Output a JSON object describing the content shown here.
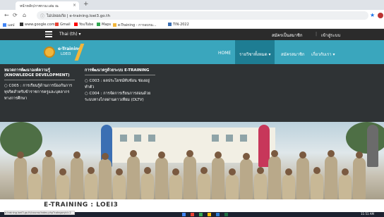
{
  "browser": {
    "tab_title": "หน้าหลัก/ภาพรวม:เล่ม ณ",
    "tab_close": "×",
    "new_tab": "+",
    "url": "ไม่ปลอดภัย | e-training.loei3.go.th",
    "star": "★",
    "bookmarks": [
      "แอป",
      "www.google.com",
      "Gmail",
      "YouTube",
      "Maps",
      "e-Training - การอบรม...",
      "TIN-2022"
    ]
  },
  "site_top": {
    "language": "Thai (th) ▾",
    "signup": "สมัครเป็นสมาชิก",
    "separator": "|",
    "login": "เข้าสู่ระบบ"
  },
  "brand": {
    "line1": "e-Training",
    "line2": "LOEI3"
  },
  "nav": {
    "items": [
      "HOME",
      "รายวิชาทั้งหมด ▾",
      "สมัครสมาชิก",
      "เกี่ยวกับเรา ▾"
    ]
  },
  "dropdown": {
    "col1": {
      "heading": "หมวดการพัฒนาองค์ความรู้ (KNOWLEDGE DEVELOPMENT)",
      "items": [
        "○ C005 : การเรียนรู้ด้านการป้องกันการทุจริตสำหรับข้าราชการครูและบุคลากรทางการศึกษา"
      ]
    },
    "col2": {
      "heading": "การพัฒนาครูด้วยระบบ E-TRAINING",
      "items": [
        "○ C003 : ผลประโยชน์ทับซ้อน ช่องอยู่ทำตัว",
        "○ C004 : การจัดการเรียนการสอนด้วยระบบทางไกลผ่านดาวเทียม (DLTV)"
      ]
    }
  },
  "page": {
    "title": "E-TRAINING : LOEI3"
  },
  "status": {
    "link_url": "e-training.loei3.go.th/course/index.php?categoryid=2",
    "clock": "11:51 AM"
  },
  "colors": {
    "navbar": "#3aa6bd",
    "nav_active": "#1e7d93",
    "topbar": "#2b2b2b",
    "accent": "#f2b63b"
  }
}
